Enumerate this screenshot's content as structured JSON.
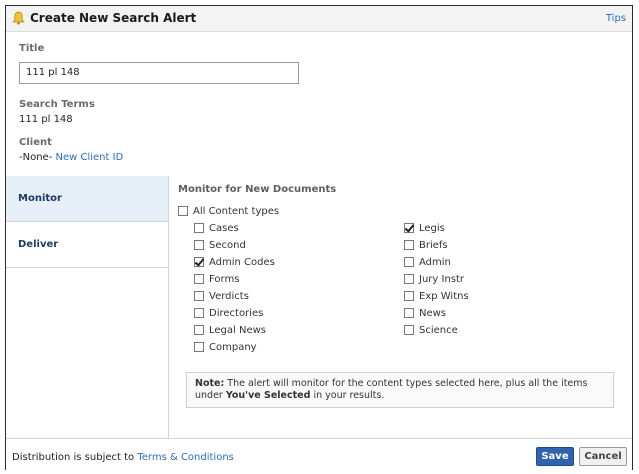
{
  "dialog": {
    "title": "Create New Search Alert",
    "tips_label": "Tips"
  },
  "fields": {
    "title_label": "Title",
    "title_value": "111 pl 148",
    "search_terms_label": "Search Terms",
    "search_terms_value": "111 pl 148",
    "client_label": "Client",
    "client_value": "-None-",
    "new_client_link": "New Client ID"
  },
  "sidebar": {
    "items": [
      {
        "label": "Monitor",
        "active": true
      },
      {
        "label": "Deliver",
        "active": false
      }
    ]
  },
  "monitor": {
    "heading": "Monitor for New Documents",
    "all_types": {
      "label": "All Content types",
      "checked": false
    },
    "left_options": [
      {
        "label": "Cases",
        "checked": false
      },
      {
        "label": "Second",
        "checked": false
      },
      {
        "label": "Admin Codes",
        "checked": true
      },
      {
        "label": "Forms",
        "checked": false
      },
      {
        "label": "Verdicts",
        "checked": false
      },
      {
        "label": "Directories",
        "checked": false
      },
      {
        "label": "Legal News",
        "checked": false
      },
      {
        "label": "Company",
        "checked": false
      }
    ],
    "right_options": [
      {
        "label": "Legis",
        "checked": true
      },
      {
        "label": "Briefs",
        "checked": false
      },
      {
        "label": "Admin",
        "checked": false
      },
      {
        "label": "Jury Instr",
        "checked": false
      },
      {
        "label": "Exp Witns",
        "checked": false
      },
      {
        "label": "News",
        "checked": false
      },
      {
        "label": "Science",
        "checked": false
      }
    ],
    "note_label": "Note:",
    "note_text": "The alert will monitor for the content types selected here, plus all the items under",
    "note_bold": "You've Selected",
    "note_end": "in your results."
  },
  "footer": {
    "distribution_text": "Distribution is subject to",
    "terms_link": "Terms & Conditions",
    "save_label": "Save",
    "cancel_label": "Cancel"
  },
  "colors": {
    "accent": "#2a6ebd",
    "save_button": "#2f63ad",
    "sidebar_active": "#e6eef8"
  }
}
